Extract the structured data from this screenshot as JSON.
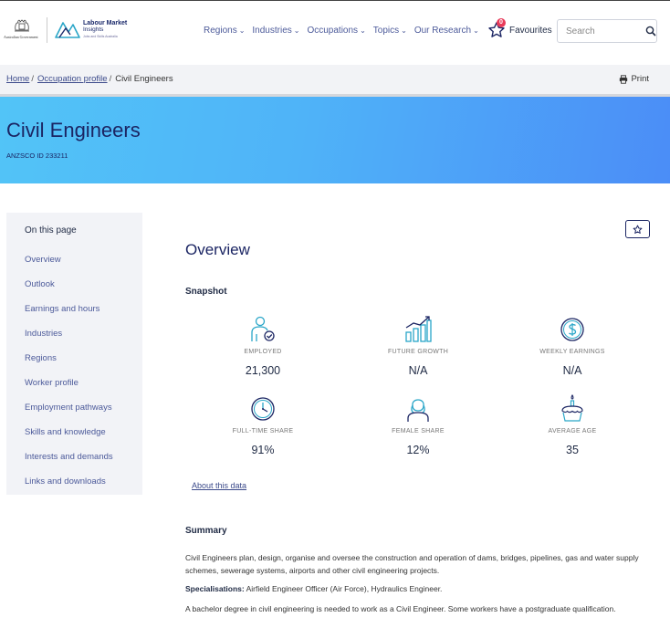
{
  "header": {
    "gov_text": "Australian Government",
    "brand_line1": "Labour Market",
    "brand_line2": "Insights",
    "brand_line3": "Jobs and Skills Australia",
    "nav": [
      {
        "label": "Regions"
      },
      {
        "label": "Industries"
      },
      {
        "label": "Occupations"
      },
      {
        "label": "Topics"
      },
      {
        "label": "Our Research"
      }
    ],
    "favourites_label": "Favourites",
    "favourites_count": "0",
    "search_placeholder": "Search"
  },
  "breadcrumb": {
    "items": [
      "Home",
      "Occupation profile"
    ],
    "current": "Civil Engineers",
    "print_label": "Print"
  },
  "hero": {
    "title": "Civil Engineers",
    "anzsco": "ANZSCO ID 233211"
  },
  "sidebar": {
    "title": "On this page",
    "items": [
      {
        "label": "Overview"
      },
      {
        "label": "Outlook"
      },
      {
        "label": "Earnings and hours"
      },
      {
        "label": "Industries"
      },
      {
        "label": "Regions"
      },
      {
        "label": "Worker profile"
      },
      {
        "label": "Employment pathways"
      },
      {
        "label": "Skills and knowledge"
      },
      {
        "label": "Interests and demands"
      },
      {
        "label": "Links and downloads"
      }
    ]
  },
  "main": {
    "overview_heading": "Overview",
    "snapshot_heading": "Snapshot",
    "stats": [
      {
        "label": "EMPLOYED",
        "value": "21,300",
        "icon": "employed-person-icon"
      },
      {
        "label": "FUTURE GROWTH",
        "value": "N/A",
        "icon": "growth-chart-icon"
      },
      {
        "label": "WEEKLY EARNINGS",
        "value": "N/A",
        "icon": "dollar-coin-icon"
      },
      {
        "label": "FULL-TIME SHARE",
        "value": "91%",
        "icon": "clock-icon"
      },
      {
        "label": "FEMALE SHARE",
        "value": "12%",
        "icon": "female-person-icon"
      },
      {
        "label": "AVERAGE AGE",
        "value": "35",
        "icon": "birthday-cake-icon"
      }
    ],
    "about_link": "About this data",
    "summary_heading": "Summary",
    "summary_text": "Civil Engineers plan, design, organise and oversee the construction and operation of dams, bridges, pipelines, gas and water supply schemes, sewerage systems, airports and other civil engineering projects.",
    "specialisations_label": "Specialisations:",
    "specialisations_text": "Airfield Engineer Officer (Air Force), Hydraulics Engineer.",
    "education_text": "A bachelor degree in civil engineering is needed to work as a Civil Engineer. Some workers have a postgraduate qualification."
  },
  "colors": {
    "navy": "#1b2563",
    "link": "#4c5a9a",
    "icon_teal": "#2aa6c8",
    "badge": "#e83b5a"
  }
}
